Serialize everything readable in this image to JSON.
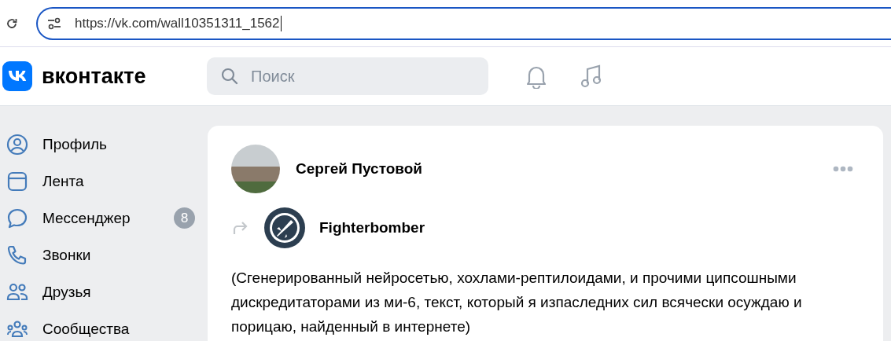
{
  "browser": {
    "address": "https://vk.com/wall10351311_1562"
  },
  "header": {
    "logo_text": "вконтакте",
    "search": {
      "placeholder": "Поиск"
    }
  },
  "sidebar": {
    "items": [
      {
        "label": "Профиль",
        "kind": "profile"
      },
      {
        "label": "Лента",
        "kind": "feed"
      },
      {
        "label": "Мессенджер",
        "kind": "messenger",
        "badge": "8"
      },
      {
        "label": "Звонки",
        "kind": "calls"
      },
      {
        "label": "Друзья",
        "kind": "friends"
      },
      {
        "label": "Сообщества",
        "kind": "communities"
      }
    ]
  },
  "post": {
    "author": "Сергей Пустовой",
    "repost_source": "Fighterbomber",
    "text": "(Сгенерированный нейросетью, хохлами-рептилоидами, и прочими ципсошными дискредитаторами из ми-6, текст, который я изпаследних сил всячески осуждаю и порицаю, найденный в интернете)"
  }
}
